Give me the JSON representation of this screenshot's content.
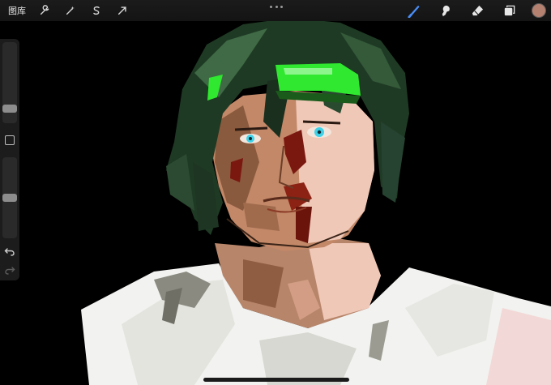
{
  "toolbar": {
    "gallery_label": "图库",
    "left_tools": [
      {
        "name": "actions",
        "icon": "wrench-icon"
      },
      {
        "name": "adjustments",
        "icon": "magic-wand-icon"
      },
      {
        "name": "selection",
        "icon": "selection-s-icon"
      },
      {
        "name": "transform",
        "icon": "arrow-cursor-icon"
      }
    ],
    "right_tools": [
      {
        "name": "brush",
        "icon": "brush-icon",
        "active": true,
        "color": "#4a8df7"
      },
      {
        "name": "smudge",
        "icon": "smudge-icon",
        "active": false,
        "color": "#e6e6e6"
      },
      {
        "name": "eraser",
        "icon": "eraser-icon",
        "active": false,
        "color": "#e6e6e6"
      },
      {
        "name": "layers",
        "icon": "layers-icon",
        "active": false,
        "color": "#e6e6e6"
      }
    ],
    "current_color": "#b48070"
  },
  "sidebar": {
    "brush_size_level": 0.15,
    "opacity_level": 0.5
  },
  "palette": {
    "hair": "#1f3a24",
    "hair_light": "#3f6a45",
    "headband": "#2fe82f",
    "skin": "#c28868",
    "skin_light": "#f0c8b8",
    "blood": "#7a1810",
    "eyes": "#3fd2e8",
    "shirt": "#f2f2f0",
    "shirt_shadow": "#8a8a80"
  }
}
